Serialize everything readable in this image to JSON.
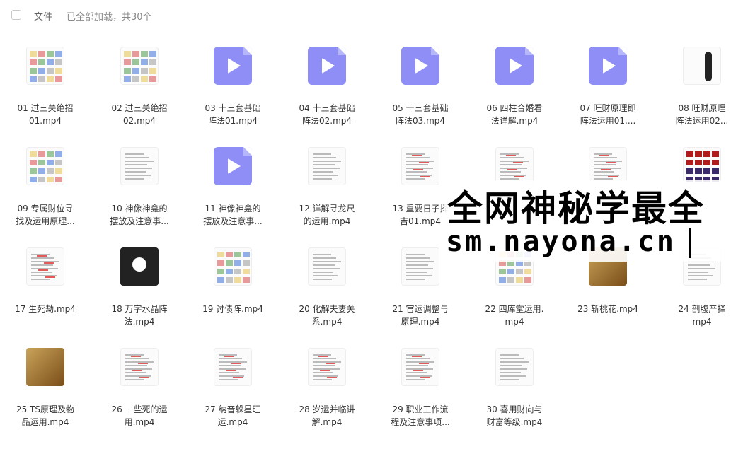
{
  "header": {
    "files_label": "文件",
    "status_text": "已全部加载，共30个"
  },
  "files": [
    {
      "line1": "01 过三关绝招",
      "line2": "01.mp4",
      "thumb": "chart"
    },
    {
      "line1": "02 过三关绝招",
      "line2": "02.mp4",
      "thumb": "chart"
    },
    {
      "line1": "03 十三套基础",
      "line2": "阵法01.mp4",
      "thumb": "video"
    },
    {
      "line1": "04 十三套基础",
      "line2": "阵法02.mp4",
      "thumb": "video"
    },
    {
      "line1": "05 十三套基础",
      "line2": "阵法03.mp4",
      "thumb": "video"
    },
    {
      "line1": "06 四柱合婚看",
      "line2": "法详解.mp4",
      "thumb": "video"
    },
    {
      "line1": "07 旺财原理即",
      "line2": "阵法运用01....",
      "thumb": "video"
    },
    {
      "line1": "08 旺财原理",
      "line2": "阵法运用02...",
      "thumb": "figure"
    },
    {
      "line1": "09 专属财位寻",
      "line2": "找及运用原理...",
      "thumb": "chart"
    },
    {
      "line1": "10 神像神龛的",
      "line2": "摆放及注意事...",
      "thumb": "doc"
    },
    {
      "line1": "11 神像神龛的",
      "line2": "摆放及注意事...",
      "thumb": "video"
    },
    {
      "line1": "12 详解寻龙尺",
      "line2": "的运用.mp4",
      "thumb": "doc"
    },
    {
      "line1": "13 重要日子择",
      "line2": "吉01.mp4",
      "thumb": "docred"
    },
    {
      "line1": "",
      "line2": "",
      "thumb": "docred"
    },
    {
      "line1": "",
      "line2": "",
      "thumb": "docred"
    },
    {
      "line1": "",
      "line2": "",
      "thumb": "tiles"
    },
    {
      "line1": "17 生死劫.mp4",
      "line2": "",
      "thumb": "docred"
    },
    {
      "line1": "18 万字水晶阵",
      "line2": "法.mp4",
      "thumb": "logo"
    },
    {
      "line1": "19 讨债阵.mp4",
      "line2": "",
      "thumb": "grid"
    },
    {
      "line1": "20 化解夫妻关",
      "line2": "系.mp4",
      "thumb": "doc"
    },
    {
      "line1": "21 官运调整与",
      "line2": "原理.mp4",
      "thumb": "doc"
    },
    {
      "line1": "22 四库堂运用.",
      "line2": "mp4",
      "thumb": "chart"
    },
    {
      "line1": "23 斩桃花.mp4",
      "line2": "",
      "thumb": "photo"
    },
    {
      "line1": "24 剖腹产择",
      "line2": "mp4",
      "thumb": "doc"
    },
    {
      "line1": "25 TS原理及物",
      "line2": "品运用.mp4",
      "thumb": "photo"
    },
    {
      "line1": "26 一些死的运",
      "line2": "用.mp4",
      "thumb": "docred"
    },
    {
      "line1": "27 纳音躲星旺",
      "line2": "运.mp4",
      "thumb": "docred"
    },
    {
      "line1": "28 岁运并临讲",
      "line2": "解.mp4",
      "thumb": "docred"
    },
    {
      "line1": "29 职业工作流",
      "line2": "程及注意事项...",
      "thumb": "docred"
    },
    {
      "line1": "30 喜用财向与",
      "line2": "财富等级.mp4",
      "thumb": "doc"
    }
  ],
  "watermark": {
    "title": "全网神秘学最全",
    "url": "sm.nayona.cn"
  },
  "colors": {
    "video_icon": "#8e8ef6",
    "text": "#333333",
    "muted": "#888888"
  }
}
